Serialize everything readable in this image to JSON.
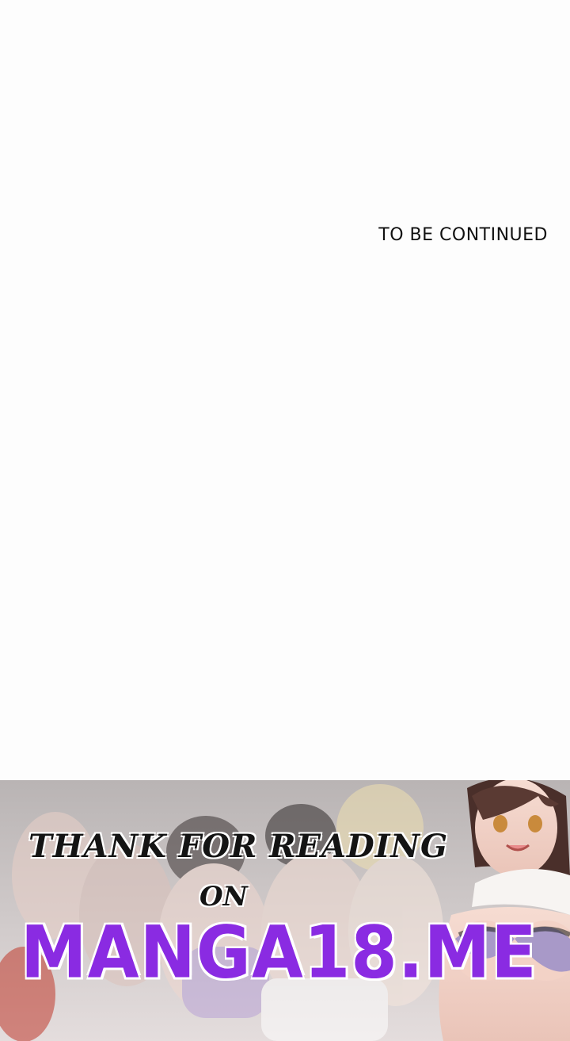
{
  "chapter_end": {
    "text": "TO BE CONTINUED"
  },
  "banner": {
    "line1": "THANK FOR READING",
    "line2": "ON",
    "site": "MANGA18.ME",
    "site_color": "#8a2be2",
    "text_color": "#141414"
  }
}
